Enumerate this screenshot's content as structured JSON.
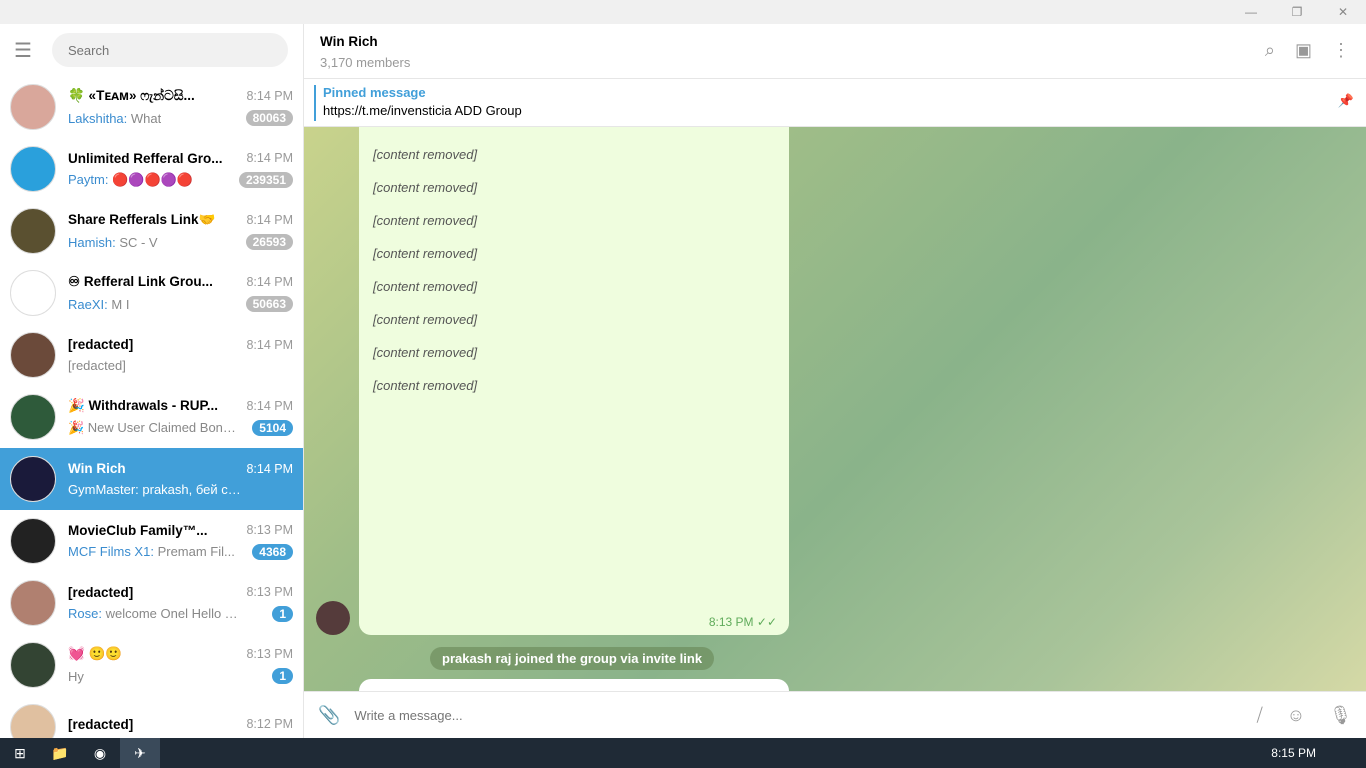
{
  "window": {
    "minimize": "—",
    "restore": "❐",
    "close": "✕"
  },
  "sidebar": {
    "search_placeholder": "Search",
    "chats": [
      {
        "name": "🍀 «Tᴇᴀᴍ» ෆැන්ටසි...",
        "time": "8:14 PM",
        "sender": "Lakshitha:",
        "preview": "What",
        "badge": "80063",
        "color": "#d9a79b"
      },
      {
        "name": "Unlimited Refferal Gro...",
        "time": "8:14 PM",
        "sender": "Paytm:",
        "preview": "🔴🟣🔴🟣🔴",
        "badge": "239351",
        "color": "#2aa0dc"
      },
      {
        "name": "Share Refferals Link🤝",
        "time": "8:14 PM",
        "sender": "Hamish:",
        "preview": "SC - V",
        "badge": "26593",
        "color": "#5a5030"
      },
      {
        "name": "♾ Refferal Link Grou...",
        "time": "8:14 PM",
        "sender": "RaeXI:",
        "preview": "M I",
        "badge": "50663",
        "color": "#ffffff"
      },
      {
        "name": "[redacted]",
        "time": "8:14 PM",
        "sender": "",
        "preview": "[redacted]",
        "badge": "",
        "color": "#6b4a3a"
      },
      {
        "name": "🎉 Withdrawals - RUP...",
        "time": "8:14 PM",
        "sender": "",
        "preview": "🎉 New User Claimed Bonus...",
        "badge": "5104",
        "color": "#2e5a3a"
      },
      {
        "name": "Win Rich",
        "time": "8:14 PM",
        "sender": "",
        "preview": "GymMaster: prakash, бей своих др...",
        "badge": "",
        "color": "#1a1a3a"
      },
      {
        "name": "MovieClub Family™...",
        "time": "8:13 PM",
        "sender": "MCF Films X1:",
        "preview": "Premam Fil...",
        "badge": "4368",
        "color": "#222222"
      },
      {
        "name": "[redacted]",
        "time": "8:13 PM",
        "sender": "Rose:",
        "preview": "welcome Onel Hello  This ...",
        "badge": "1",
        "color": "#b08070"
      },
      {
        "name": "💓 🙂🙂",
        "time": "8:13 PM",
        "sender": "",
        "preview": "Hy",
        "badge": "1",
        "color": "#334433"
      },
      {
        "name": "[redacted]",
        "time": "8:12 PM",
        "sender": "",
        "preview": "",
        "badge": "",
        "color": "#e0c0a0"
      }
    ]
  },
  "header": {
    "title": "Win Rich",
    "members": "3,170 members"
  },
  "pinned": {
    "label": "Pinned message",
    "text": "https://t.me/invensticia ADD Group"
  },
  "message": {
    "lines": [
      "[content removed]",
      "[content removed]",
      "[content removed]",
      "[content removed]",
      "[content removed]",
      "[content removed]",
      "[content removed]",
      "[content removed]"
    ],
    "time": "8:13 PM ✓✓"
  },
  "service": "prakash raj joined the group via invite link",
  "compose": {
    "placeholder": "Write a message..."
  },
  "taskbar": {
    "time": "8:15 PM"
  }
}
